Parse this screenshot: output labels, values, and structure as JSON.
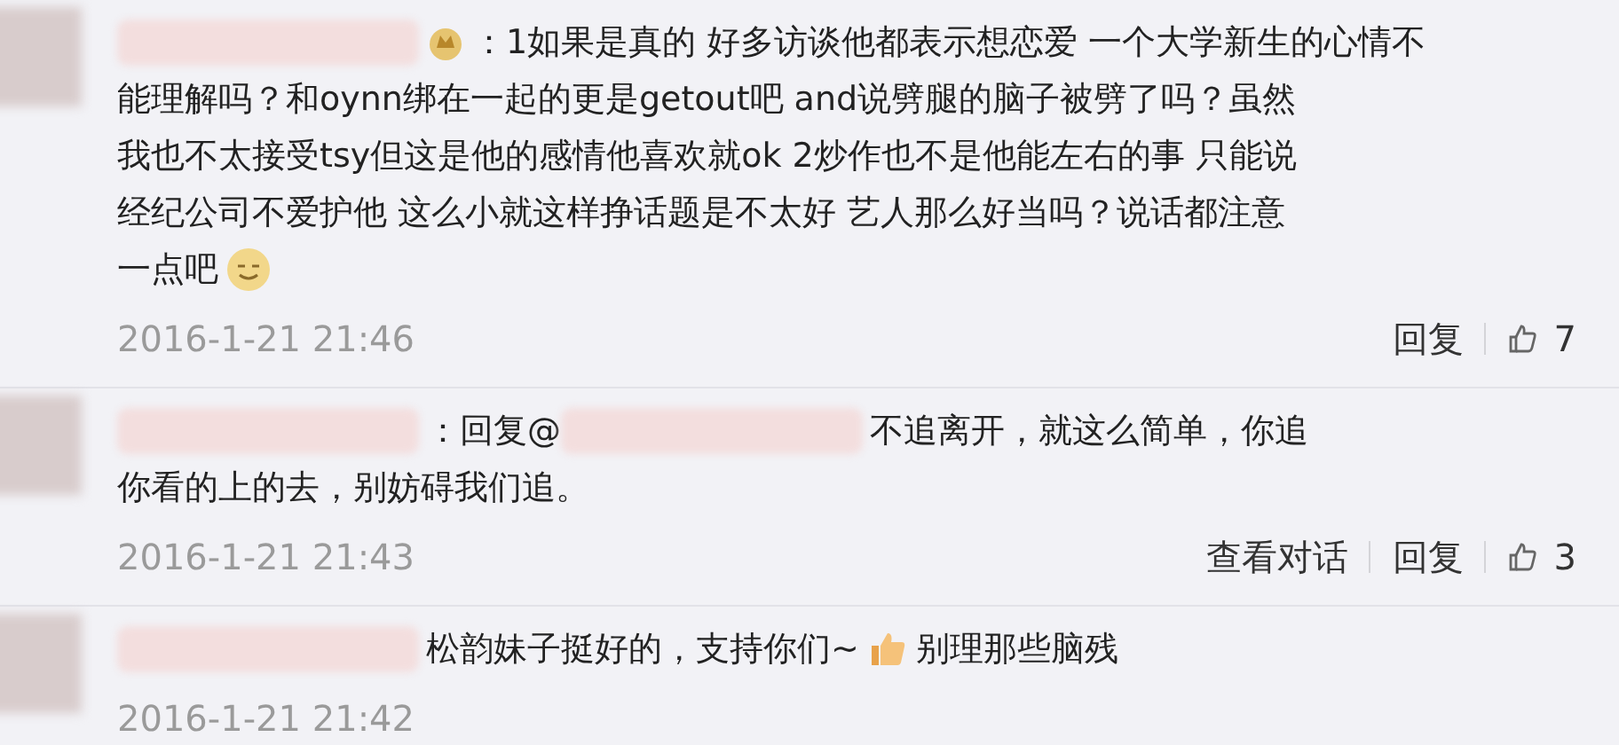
{
  "comments": [
    {
      "lines": [
        [
          {
            "kind": "redacted"
          },
          {
            "kind": "badge"
          },
          {
            "kind": "text",
            "text": "：1如果是真的 好多访谈他都表示想恋爱 一个大学新生的心情不"
          }
        ],
        [
          {
            "kind": "text",
            "text": "能理解吗？和oynn绑在一起的更是getout吧 and说劈腿的脑子被劈了吗？虽然"
          }
        ],
        [
          {
            "kind": "text",
            "text": "我也不太接受tsy但这是他的感情他喜欢就ok 2炒作也不是他能左右的事 只能说"
          }
        ],
        [
          {
            "kind": "text",
            "text": "经纪公司不爱护他 这么小就这样挣话题是不太好 艺人那么好当吗？说话都注意"
          }
        ],
        [
          {
            "kind": "text",
            "text": "一点吧"
          },
          {
            "kind": "smile"
          }
        ]
      ],
      "time": "2016-1-21 21:46",
      "actions": [
        "回复"
      ],
      "likes": "7"
    },
    {
      "lines": [
        [
          {
            "kind": "redacted"
          },
          {
            "kind": "text",
            "text": "：回复@"
          },
          {
            "kind": "redacted"
          },
          {
            "kind": "text",
            "text": "不追离开，就这么简单，你追"
          }
        ],
        [
          {
            "kind": "text",
            "text": "你看的上的去，别妨碍我们追。"
          }
        ]
      ],
      "time": "2016-1-21 21:43",
      "actions": [
        "查看对话",
        "回复"
      ],
      "likes": "3"
    },
    {
      "lines": [
        [
          {
            "kind": "redacted"
          },
          {
            "kind": "text",
            "text": "松韵妹子挺好的，支持你们~"
          },
          {
            "kind": "thumb"
          },
          {
            "kind": "text",
            "text": "别理那些脑残"
          }
        ]
      ],
      "time": "2016-1-21 21:42"
    }
  ]
}
